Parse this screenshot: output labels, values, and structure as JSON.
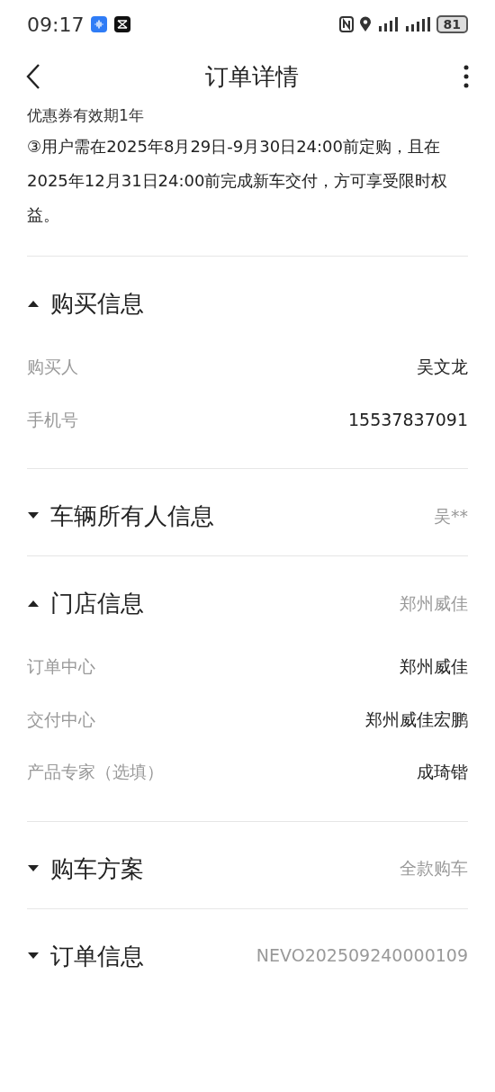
{
  "status_bar": {
    "time": "09:17",
    "battery": "81"
  },
  "header": {
    "title": "订单详情"
  },
  "notice": [
    "优惠券有效期1年",
    "③用户需在2025年8月29日-9月30日24:00前定购，且在2025年12月31日24:00前完成新车交付，方可享受限时权益。"
  ],
  "sections": [
    {
      "title": "购买信息",
      "expanded": true,
      "rows": [
        {
          "label": "购买人",
          "value": "吴文龙"
        },
        {
          "label": "手机号",
          "value": "15537837091"
        }
      ]
    },
    {
      "title": "车辆所有人信息",
      "expanded": false,
      "summary": "吴**"
    },
    {
      "title": "门店信息",
      "expanded": true,
      "summary": "郑州威佳",
      "rows": [
        {
          "label": "订单中心",
          "value": "郑州威佳"
        },
        {
          "label": "交付中心",
          "value": "郑州威佳宏鹏"
        },
        {
          "label": "产品专家（选填）",
          "value": "成琦锴"
        }
      ]
    },
    {
      "title": "购车方案",
      "expanded": false,
      "summary": "全款购车"
    },
    {
      "title": "订单信息",
      "expanded": false,
      "summary": "NEVO202509240000109"
    }
  ]
}
